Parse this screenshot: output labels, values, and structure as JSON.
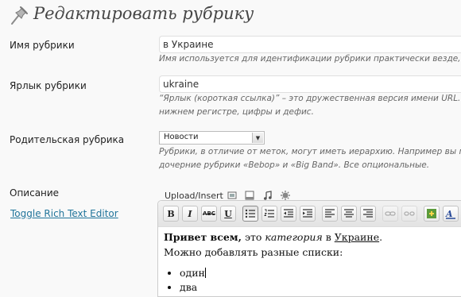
{
  "header": {
    "title": "Редактировать рубрику",
    "icon": "pushpin-icon"
  },
  "form": {
    "name": {
      "label": "Имя рубрики",
      "value": "в Украине",
      "description": "Имя используется для идентификации рубрики практически везде, на"
    },
    "slug": {
      "label": "Ярлык рубрики",
      "value": "ukraine",
      "description_line1": "“Ярлык (короткая ссылка)” – это дружественная версия имени URL. К",
      "description_line2": "нижнем регистре, цифры и дефис."
    },
    "parent": {
      "label": "Родительская рубрика",
      "selected": "Новости",
      "description_line1": "Рубрики, в отличие от меток, могут иметь иерархию. Например вы мо",
      "description_line2": "дочерние рубрики «Bebop» и «Big Band». Все опциональные."
    },
    "description": {
      "label": "Описание",
      "toggle_link": "Toggle Rich Text Editor",
      "upload_label": "Upload/Insert"
    }
  },
  "toolbar": {
    "bold": "B",
    "italic": "I",
    "strikethrough": "ABC",
    "underline": "U"
  },
  "editor": {
    "bold_text": "Привет всем,",
    "text_part1": " это ",
    "italic_text": "категория",
    "text_part2": " в ",
    "underlined_text": "Украине",
    "text_part3": ".",
    "line2": "Можно добавлять разные списки:",
    "list_items": [
      "один",
      "два"
    ]
  },
  "colors": {
    "link": "#21759b",
    "background": "#f9f9f9",
    "title": "#464646"
  }
}
